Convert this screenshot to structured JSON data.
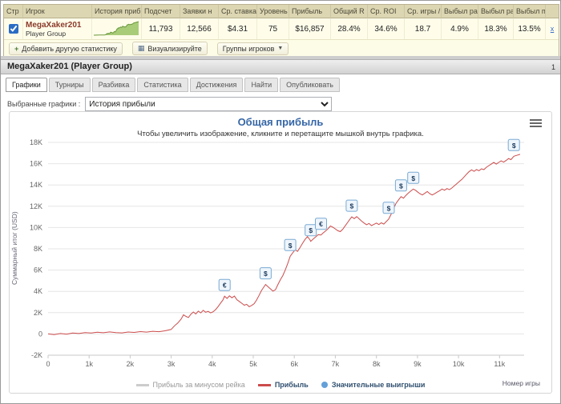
{
  "stats_table": {
    "headers": [
      "Стр",
      "Игрок",
      "История прибы",
      "Подсчет",
      "Заявки н",
      "Ср. ставка",
      "Уровень",
      "Прибыль",
      "Общий R",
      "Ср. ROI",
      "Ср. игры /",
      "Выбыл ран",
      "Выбыл ран",
      "Выбыл поз",
      ""
    ],
    "row": {
      "player_name": "MegaXaker201",
      "player_group": "Player Group",
      "values": [
        "11,793",
        "12,566",
        "$4.31",
        "75",
        "$16,857",
        "28.4%",
        "34.6%",
        "18.7",
        "4.9%",
        "18.3%",
        "13.5%"
      ],
      "remove_label": "x"
    }
  },
  "toolbar": {
    "add_icon": "+",
    "add_stat": "Добавить другую статистику",
    "visualize_icon": "▦",
    "visualize": "Визуализируйте",
    "groups": "Группы игроков",
    "caret": "▼"
  },
  "section": {
    "title": "MegaXaker201 (Player Group)",
    "page_indicator": "1"
  },
  "tabs": [
    "Графики",
    "Турниры",
    "Разбивка",
    "Статистика",
    "Достижения",
    "Найти",
    "Опубликовать"
  ],
  "chart_select": {
    "label": "Выбранные графики :",
    "value": "История прибыли"
  },
  "chart_data": {
    "type": "line",
    "title": "Общая прибыль",
    "subtitle": "Чтобы увеличить изображение, кликните и перетащите мышкой внутрь графика.",
    "xlabel": "Номер игры",
    "ylabel": "Суммарный итог (USD)",
    "xlim": [
      0,
      11600
    ],
    "ylim": [
      -2000,
      18000
    ],
    "grid": true,
    "x_ticks": [
      {
        "value": 0,
        "label": "0"
      },
      {
        "value": 1000,
        "label": "1k"
      },
      {
        "value": 2000,
        "label": "2k"
      },
      {
        "value": 3000,
        "label": "3k"
      },
      {
        "value": 4000,
        "label": "4k"
      },
      {
        "value": 5000,
        "label": "5k"
      },
      {
        "value": 6000,
        "label": "6k"
      },
      {
        "value": 7000,
        "label": "7k"
      },
      {
        "value": 8000,
        "label": "8k"
      },
      {
        "value": 9000,
        "label": "9k"
      },
      {
        "value": 10000,
        "label": "10k"
      },
      {
        "value": 11000,
        "label": "11k"
      }
    ],
    "y_ticks": [
      {
        "value": -2000,
        "label": "-2K"
      },
      {
        "value": 0,
        "label": "0"
      },
      {
        "value": 2000,
        "label": "2K"
      },
      {
        "value": 4000,
        "label": "4K"
      },
      {
        "value": 6000,
        "label": "6K"
      },
      {
        "value": 8000,
        "label": "8K"
      },
      {
        "value": 10000,
        "label": "10K"
      },
      {
        "value": 12000,
        "label": "12K"
      },
      {
        "value": 14000,
        "label": "14K"
      },
      {
        "value": 16000,
        "label": "16K"
      },
      {
        "value": 18000,
        "label": "18K"
      }
    ],
    "series": [
      {
        "name": "Прибыль за минусом рейка",
        "color": "#cccccc",
        "visible": false,
        "points": []
      },
      {
        "name": "Прибыль",
        "color": "#cc4b4b",
        "points": [
          [
            0,
            0
          ],
          [
            150,
            -60
          ],
          [
            300,
            40
          ],
          [
            450,
            -30
          ],
          [
            600,
            90
          ],
          [
            750,
            40
          ],
          [
            900,
            130
          ],
          [
            1050,
            80
          ],
          [
            1200,
            160
          ],
          [
            1350,
            110
          ],
          [
            1500,
            190
          ],
          [
            1650,
            130
          ],
          [
            1800,
            100
          ],
          [
            1950,
            180
          ],
          [
            2100,
            140
          ],
          [
            2250,
            220
          ],
          [
            2400,
            170
          ],
          [
            2550,
            250
          ],
          [
            2700,
            210
          ],
          [
            2850,
            290
          ],
          [
            3000,
            420
          ],
          [
            3080,
            760
          ],
          [
            3160,
            1020
          ],
          [
            3240,
            1380
          ],
          [
            3300,
            1800
          ],
          [
            3360,
            1650
          ],
          [
            3420,
            1540
          ],
          [
            3480,
            1860
          ],
          [
            3540,
            2060
          ],
          [
            3600,
            1880
          ],
          [
            3660,
            2140
          ],
          [
            3720,
            1980
          ],
          [
            3780,
            2220
          ],
          [
            3840,
            2040
          ],
          [
            3900,
            2120
          ],
          [
            3960,
            1980
          ],
          [
            4020,
            2080
          ],
          [
            4080,
            2280
          ],
          [
            4140,
            2560
          ],
          [
            4200,
            2880
          ],
          [
            4260,
            3180
          ],
          [
            4300,
            3550
          ],
          [
            4360,
            3340
          ],
          [
            4420,
            3580
          ],
          [
            4480,
            3400
          ],
          [
            4540,
            3560
          ],
          [
            4600,
            3220
          ],
          [
            4660,
            3050
          ],
          [
            4720,
            2880
          ],
          [
            4780,
            2700
          ],
          [
            4840,
            2780
          ],
          [
            4900,
            2560
          ],
          [
            4960,
            2680
          ],
          [
            5020,
            2840
          ],
          [
            5080,
            3180
          ],
          [
            5140,
            3620
          ],
          [
            5200,
            4080
          ],
          [
            5260,
            4420
          ],
          [
            5300,
            4650
          ],
          [
            5360,
            4430
          ],
          [
            5420,
            4230
          ],
          [
            5480,
            4020
          ],
          [
            5540,
            4150
          ],
          [
            5600,
            4650
          ],
          [
            5660,
            5080
          ],
          [
            5720,
            5480
          ],
          [
            5780,
            6020
          ],
          [
            5840,
            6620
          ],
          [
            5900,
            7300
          ],
          [
            5960,
            7620
          ],
          [
            6020,
            7900
          ],
          [
            6080,
            7760
          ],
          [
            6140,
            8120
          ],
          [
            6200,
            8520
          ],
          [
            6260,
            8880
          ],
          [
            6320,
            9140
          ],
          [
            6380,
            8860
          ],
          [
            6400,
            8700
          ],
          [
            6460,
            8920
          ],
          [
            6520,
            9120
          ],
          [
            6580,
            9320
          ],
          [
            6650,
            9300
          ],
          [
            6700,
            9480
          ],
          [
            6760,
            9680
          ],
          [
            6820,
            9880
          ],
          [
            6880,
            10140
          ],
          [
            6940,
            10020
          ],
          [
            7000,
            9870
          ],
          [
            7060,
            9700
          ],
          [
            7120,
            9620
          ],
          [
            7180,
            9840
          ],
          [
            7240,
            10160
          ],
          [
            7300,
            10480
          ],
          [
            7350,
            10760
          ],
          [
            7400,
            11000
          ],
          [
            7460,
            10840
          ],
          [
            7520,
            11020
          ],
          [
            7580,
            10820
          ],
          [
            7640,
            10600
          ],
          [
            7700,
            10420
          ],
          [
            7760,
            10260
          ],
          [
            7820,
            10380
          ],
          [
            7880,
            10180
          ],
          [
            7940,
            10300
          ],
          [
            8000,
            10420
          ],
          [
            8060,
            10280
          ],
          [
            8120,
            10440
          ],
          [
            8180,
            10320
          ],
          [
            8240,
            10560
          ],
          [
            8300,
            10800
          ],
          [
            8360,
            11260
          ],
          [
            8420,
            11780
          ],
          [
            8480,
            12280
          ],
          [
            8540,
            12600
          ],
          [
            8600,
            12900
          ],
          [
            8660,
            12760
          ],
          [
            8720,
            13020
          ],
          [
            8780,
            13240
          ],
          [
            8840,
            13440
          ],
          [
            8900,
            13620
          ],
          [
            8960,
            13480
          ],
          [
            9000,
            13350
          ],
          [
            9060,
            13180
          ],
          [
            9120,
            13060
          ],
          [
            9180,
            13220
          ],
          [
            9240,
            13380
          ],
          [
            9300,
            13180
          ],
          [
            9360,
            13060
          ],
          [
            9420,
            13180
          ],
          [
            9480,
            13320
          ],
          [
            9540,
            13460
          ],
          [
            9600,
            13620
          ],
          [
            9660,
            13500
          ],
          [
            9720,
            13660
          ],
          [
            9780,
            13560
          ],
          [
            9840,
            13720
          ],
          [
            9900,
            13920
          ],
          [
            9960,
            14120
          ],
          [
            10020,
            14320
          ],
          [
            10080,
            14520
          ],
          [
            10140,
            14760
          ],
          [
            10200,
            15020
          ],
          [
            10260,
            15260
          ],
          [
            10320,
            15420
          ],
          [
            10380,
            15280
          ],
          [
            10440,
            15440
          ],
          [
            10500,
            15340
          ],
          [
            10560,
            15520
          ],
          [
            10620,
            15440
          ],
          [
            10680,
            15660
          ],
          [
            10740,
            15820
          ],
          [
            10800,
            15960
          ],
          [
            10860,
            16120
          ],
          [
            10920,
            15960
          ],
          [
            10980,
            16120
          ],
          [
            11040,
            16260
          ],
          [
            11100,
            16140
          ],
          [
            11160,
            16300
          ],
          [
            11220,
            16480
          ],
          [
            11280,
            16380
          ],
          [
            11350,
            16700
          ],
          [
            11420,
            16780
          ],
          [
            11500,
            16880
          ]
        ]
      }
    ],
    "significant_wins": {
      "name": "Значительные выигрыши",
      "color": "#64a0d8",
      "items": [
        {
          "x": 4300,
          "value": 3550,
          "symbol": "€"
        },
        {
          "x": 5300,
          "value": 4650,
          "symbol": "$"
        },
        {
          "x": 5900,
          "value": 7300,
          "symbol": "$"
        },
        {
          "x": 6400,
          "value": 8700,
          "symbol": "$"
        },
        {
          "x": 6650,
          "value": 9300,
          "symbol": "€"
        },
        {
          "x": 7400,
          "value": 11000,
          "symbol": "$"
        },
        {
          "x": 8300,
          "value": 10800,
          "symbol": "$"
        },
        {
          "x": 8600,
          "value": 12900,
          "symbol": "$"
        },
        {
          "x": 8900,
          "value": 13620,
          "symbol": "$"
        },
        {
          "x": 11350,
          "value": 16700,
          "symbol": "$"
        }
      ]
    },
    "legend": [
      {
        "label": "Прибыль за минусом рейка",
        "color": "#cccccc",
        "type": "line",
        "muted": true
      },
      {
        "label": "Прибыль",
        "color": "#cc4b4b",
        "type": "line",
        "muted": false
      },
      {
        "label": "Значительные выигрыши",
        "color": "#64a0d8",
        "type": "dot",
        "muted": false
      }
    ],
    "legend_position": "bottom-center"
  }
}
